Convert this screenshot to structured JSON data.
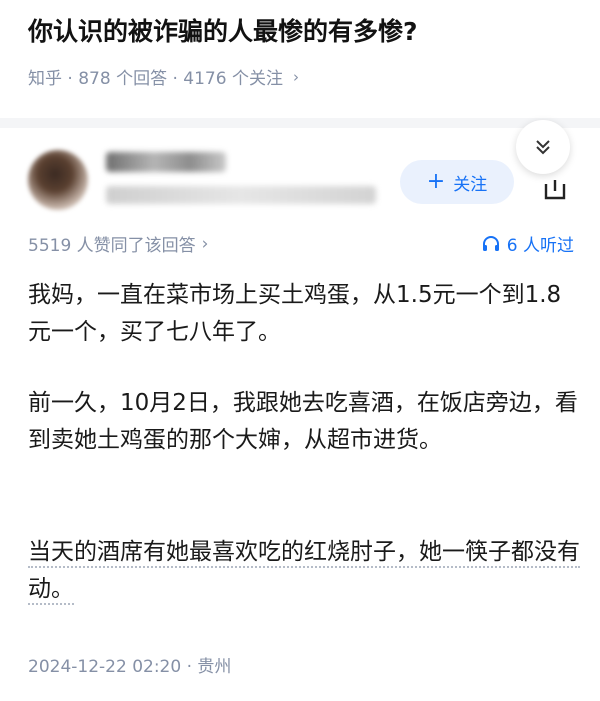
{
  "question": {
    "title": "你认识的被诈骗的人最惨的有多惨?",
    "meta": "知乎 · 878 个回答 · 4176 个关注",
    "meta_chevron": "›"
  },
  "author": {
    "follow_label": "关注",
    "follow_plus": "+"
  },
  "answer": {
    "upvote_text": "5519 人赞同了该回答",
    "upvote_chevron": "›",
    "listeners_text": "6 人听过",
    "paragraphs": [
      "我妈，一直在菜市场上买土鸡蛋，从1.5元一个到1.8元一个，买了七八年了。",
      "前一久，10月2日，我跟她去吃喜酒，在饭店旁边，看到卖她土鸡蛋的那个大婶，从超市进货。",
      "当天的酒席有她最喜欢吃的红烧肘子，她一筷子都没有动。"
    ],
    "footer": "2024-12-22 02:20 · 贵州"
  },
  "icons": {
    "collapse": "double-chevron-down-icon",
    "share": "share-icon",
    "listen": "headphones-icon"
  },
  "colors": {
    "accent": "#1772f6",
    "meta_gray": "#8590a6",
    "follow_bg": "#eaf1fd"
  }
}
